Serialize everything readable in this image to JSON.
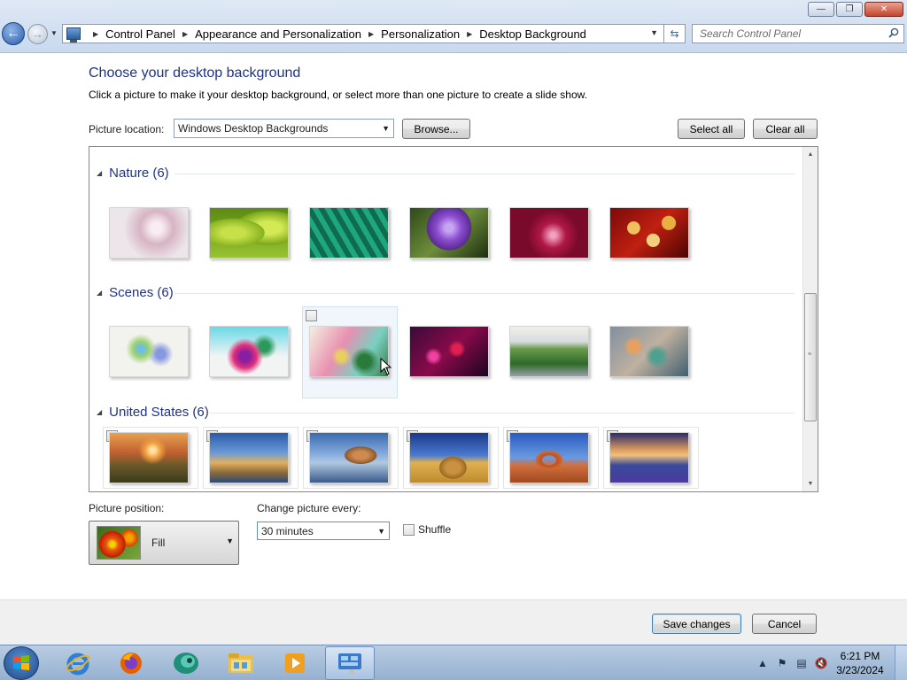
{
  "window": {
    "breadcrumb": [
      "Control Panel",
      "Appearance and Personalization",
      "Personalization",
      "Desktop Background"
    ],
    "search_placeholder": "Search Control Panel"
  },
  "page": {
    "title": "Choose your desktop background",
    "subtitle": "Click a picture to make it your desktop background, or select more than one picture to create a slide show."
  },
  "picture_location": {
    "label": "Picture location:",
    "value": "Windows Desktop Backgrounds",
    "browse_label": "Browse...",
    "select_all_label": "Select all",
    "clear_all_label": "Clear all"
  },
  "groups": [
    {
      "label": "Nature (6)",
      "items": [
        {
          "name": "Nature image 1",
          "checked": false
        },
        {
          "name": "Nature image 2",
          "checked": false
        },
        {
          "name": "Nature image 3",
          "checked": false
        },
        {
          "name": "Nature image 4",
          "checked": false
        },
        {
          "name": "Nature image 5",
          "checked": false
        },
        {
          "name": "Nature image 6",
          "checked": false
        }
      ]
    },
    {
      "label": "Scenes (6)",
      "items": [
        {
          "name": "Scenes image 1",
          "checked": false
        },
        {
          "name": "Scenes image 2",
          "checked": false
        },
        {
          "name": "Scenes image 3",
          "checked": false,
          "hovered": true
        },
        {
          "name": "Scenes image 4",
          "checked": false
        },
        {
          "name": "Scenes image 5",
          "checked": false
        },
        {
          "name": "Scenes image 6",
          "checked": false
        }
      ]
    },
    {
      "label": "United States (6)",
      "items": [
        {
          "name": "United States image 1",
          "checked": true
        },
        {
          "name": "United States image 2",
          "checked": true
        },
        {
          "name": "United States image 3",
          "checked": true
        },
        {
          "name": "United States image 4",
          "checked": true
        },
        {
          "name": "United States image 5",
          "checked": true
        },
        {
          "name": "United States image 6",
          "checked": true
        }
      ]
    }
  ],
  "picture_position": {
    "label": "Picture position:",
    "value": "Fill"
  },
  "change_picture": {
    "label": "Change picture every:",
    "value": "30 minutes"
  },
  "shuffle": {
    "label": "Shuffle",
    "checked": false
  },
  "actions": {
    "save_label": "Save changes",
    "cancel_label": "Cancel"
  },
  "taskbar": {
    "apps": [
      "Internet Explorer",
      "Firefox",
      "App",
      "Windows Explorer",
      "Windows Media Player",
      "Control Panel"
    ],
    "active_app": "Control Panel",
    "clock_time": "6:21 PM",
    "clock_date": "3/23/2024"
  },
  "colors": {
    "heading": "#1e3287",
    "chrome": "#c9d9ee",
    "taskbar": "#95b0d0"
  }
}
